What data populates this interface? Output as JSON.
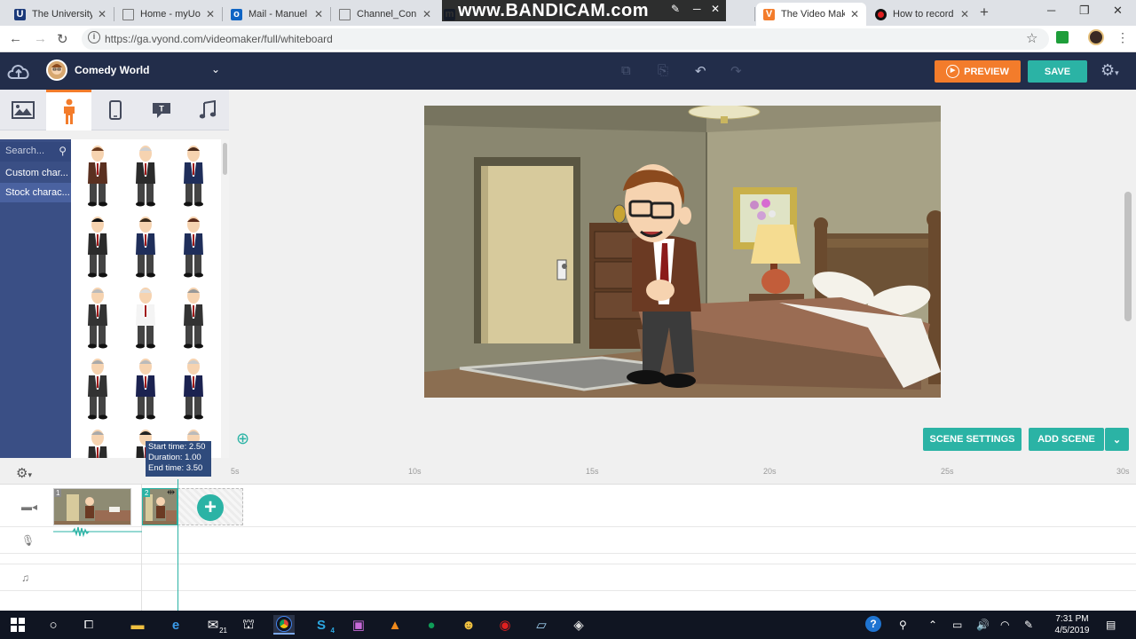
{
  "browser": {
    "tabs": [
      {
        "title": "The University",
        "icon": "university-shield-icon"
      },
      {
        "title": "Home - myUof",
        "icon": "document-icon"
      },
      {
        "title": "Mail - Manuel",
        "icon": "outlook-mail-icon"
      },
      {
        "title": "Channel_Conn",
        "icon": "document-icon"
      },
      {
        "title": "",
        "icon": "m-icon"
      },
      {
        "title": "The Video Mak",
        "icon": "vyond-v-icon"
      },
      {
        "title": "How to record",
        "icon": "record-dot-icon"
      }
    ],
    "url": "https://ga.vyond.com/videomaker/full/whiteboard",
    "overlay": "www.BANDICAM.com"
  },
  "app": {
    "project_name": "Comedy World",
    "preview_label": "PREVIEW",
    "save_label": "SAVE",
    "search_placeholder": "Search...",
    "nav_items": [
      "Custom char...",
      "Stock charac..."
    ],
    "scene_settings_label": "SCENE SETTINGS",
    "add_scene_label": "ADD SCENE",
    "accent_teal": "#2bb3a5",
    "accent_orange": "#f37c2b",
    "header_bg": "#222d4a"
  },
  "timeline": {
    "ticks": [
      "5s",
      "10s",
      "15s",
      "20s",
      "25s",
      "30s"
    ],
    "tooltip": {
      "start": "Start time: 2.50",
      "duration": "Duration: 1.00",
      "end": "End time: 3.50"
    },
    "scenes": [
      {
        "number": "1"
      },
      {
        "number": "2"
      }
    ]
  },
  "taskbar": {
    "time": "7:31 PM",
    "date": "4/5/2019",
    "mail_badge": "21",
    "skype_badge": "4"
  }
}
